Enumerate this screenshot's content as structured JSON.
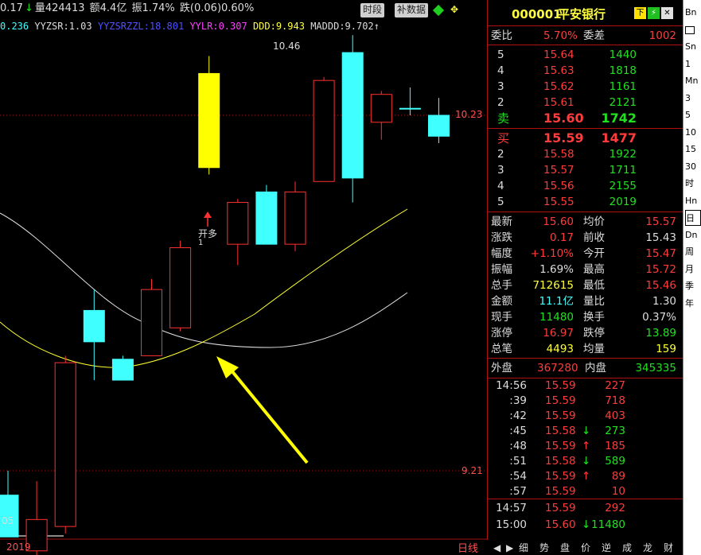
{
  "topbar": {
    "prev_change": "0.17",
    "volume": "量424413",
    "amount": "额4.4亿",
    "amplitude": "振1.74%",
    "fall": "跌(0.06)0.60%",
    "btn_time": "时段",
    "btn_supp": "补数据"
  },
  "indicators": {
    "a": "0.236",
    "yyzsr": "YYZSR:1.03",
    "yyzsrzzl": "YYZSRZZL:18.801",
    "yylr": "YYLR:0.307",
    "ddd": "DDD:9.943",
    "maddd": "MADDD:9.702"
  },
  "chart_data": {
    "type": "candlestick",
    "x_label": "2019",
    "price_labels": [
      "10.46",
      "10.23",
      "9.21",
      "05"
    ],
    "candles": [
      {
        "o": 9.14,
        "h": 9.21,
        "l": 9.02,
        "c": 9.02,
        "col": "cyan"
      },
      {
        "o": 8.98,
        "h": 9.18,
        "l": 8.96,
        "c": 9.07,
        "col": "red"
      },
      {
        "o": 9.05,
        "h": 9.54,
        "l": 9.03,
        "c": 9.52,
        "col": "red"
      },
      {
        "o": 9.67,
        "h": 9.73,
        "l": 9.47,
        "c": 9.58,
        "col": "cyan"
      },
      {
        "o": 9.53,
        "h": 9.54,
        "l": 9.47,
        "c": 9.47,
        "col": "cyan"
      },
      {
        "o": 9.54,
        "h": 9.76,
        "l": 9.54,
        "c": 9.73,
        "col": "red"
      },
      {
        "o": 9.62,
        "h": 9.87,
        "l": 9.61,
        "c": 9.85,
        "col": "red"
      },
      {
        "o": 10.08,
        "h": 10.4,
        "l": 10.06,
        "c": 10.35,
        "col": "yellow"
      },
      {
        "o": 9.86,
        "h": 9.99,
        "l": 9.8,
        "c": 9.98,
        "col": "red"
      },
      {
        "o": 10.01,
        "h": 10.03,
        "l": 9.86,
        "c": 9.86,
        "col": "cyan"
      },
      {
        "o": 9.86,
        "h": 10.04,
        "l": 9.84,
        "c": 10.01,
        "col": "red"
      },
      {
        "o": 10.04,
        "h": 10.34,
        "l": 10.04,
        "c": 10.33,
        "col": "red"
      },
      {
        "o": 10.41,
        "h": 10.46,
        "l": 9.98,
        "c": 10.05,
        "col": "cyan"
      },
      {
        "o": 10.21,
        "h": 10.3,
        "l": 10.16,
        "c": 10.29,
        "col": "red"
      },
      {
        "o": 10.25,
        "h": 10.31,
        "l": 10.23,
        "c": 10.25,
        "col": "cyan"
      },
      {
        "o": 10.23,
        "h": 10.28,
        "l": 10.15,
        "c": 10.17,
        "col": "cyan"
      }
    ],
    "signal": {
      "label": "开多",
      "sub": "1"
    }
  },
  "quote": {
    "code": "000001",
    "name": "平安银行",
    "wb_label": "委比",
    "wb": "5.70%",
    "wc_label": "委差",
    "wc": "1002",
    "sell": [
      {
        "n": "5",
        "p": "15.64",
        "v": "1440"
      },
      {
        "n": "4",
        "p": "15.63",
        "v": "1818"
      },
      {
        "n": "3",
        "p": "15.62",
        "v": "1161"
      },
      {
        "n": "2",
        "p": "15.61",
        "v": "2121"
      },
      {
        "n": "卖",
        "p": "15.60",
        "v": "1742"
      }
    ],
    "buy": [
      {
        "n": "买",
        "p": "15.59",
        "v": "1477"
      },
      {
        "n": "2",
        "p": "15.58",
        "v": "1922"
      },
      {
        "n": "3",
        "p": "15.57",
        "v": "1711"
      },
      {
        "n": "4",
        "p": "15.56",
        "v": "2155"
      },
      {
        "n": "5",
        "p": "15.55",
        "v": "2019"
      }
    ],
    "stats": [
      {
        "l1": "最新",
        "v1": "15.60",
        "l2": "均价",
        "v2": "15.57"
      },
      {
        "l1": "涨跌",
        "v1": "0.17",
        "l2": "前收",
        "v2": "15.43"
      },
      {
        "l1": "幅度",
        "v1": "+1.10%",
        "l2": "今开",
        "v2": "15.47"
      },
      {
        "l1": "振幅",
        "v1": "1.69%",
        "l2": "最高",
        "v2": "15.72"
      },
      {
        "l1": "总手",
        "v1": "712615",
        "l2": "最低",
        "v2": "15.46"
      },
      {
        "l1": "金额",
        "v1": "11.1亿",
        "l2": "量比",
        "v2": "1.30"
      },
      {
        "l1": "现手",
        "v1": "11480",
        "l2": "换手",
        "v2": "0.37%"
      },
      {
        "l1": "涨停",
        "v1": "16.97",
        "l2": "跌停",
        "v2": "13.89"
      },
      {
        "l1": "总笔",
        "v1": "4493",
        "l2": "均量",
        "v2": "159"
      }
    ],
    "outer_label": "外盘",
    "outer": "367280",
    "inner_label": "内盘",
    "inner": "345335",
    "ticks": [
      {
        "t": "14:56",
        "p": "15.59",
        "a": "",
        "v": "227"
      },
      {
        "t": ":39",
        "p": "15.59",
        "a": "",
        "v": "718"
      },
      {
        "t": ":42",
        "p": "15.59",
        "a": "",
        "v": "403"
      },
      {
        "t": ":45",
        "p": "15.58",
        "a": "↓",
        "v": "273"
      },
      {
        "t": ":48",
        "p": "15.59",
        "a": "↑",
        "v": "185"
      },
      {
        "t": ":51",
        "p": "15.58",
        "a": "↓",
        "v": "589"
      },
      {
        "t": ":54",
        "p": "15.59",
        "a": "↑",
        "v": "89"
      },
      {
        "t": ":57",
        "p": "15.59",
        "a": "",
        "v": "10"
      },
      {
        "t": "14:57",
        "p": "15.59",
        "a": "",
        "v": "292"
      },
      {
        "t": "15:00",
        "p": "15.60",
        "a": "↓",
        "v": "11480"
      }
    ]
  },
  "periods": [
    "Bn",
    "",
    "Sn",
    "1",
    "Mn",
    "3",
    "5",
    "10",
    "15",
    "30",
    "时",
    "Hn",
    "日",
    "Dn",
    "周",
    "月",
    "季",
    "年"
  ],
  "tabs": [
    "细",
    "势",
    "盘",
    "价",
    "逆",
    "成",
    "龙",
    "财"
  ],
  "bottom_label": "日线"
}
